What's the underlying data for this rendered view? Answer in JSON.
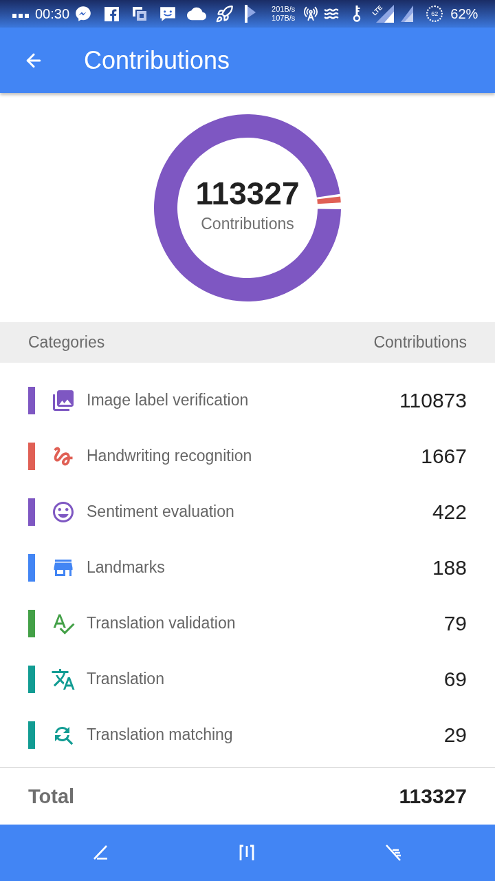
{
  "status_bar": {
    "time": "00:30",
    "net_speed": [
      "201B/s",
      "107B/s"
    ],
    "lte_label": "LTE",
    "battery_ring": "62",
    "battery": "62%"
  },
  "app_bar": {
    "title": "Contributions"
  },
  "summary": {
    "total": "113327",
    "label": "Contributions"
  },
  "table": {
    "columns": [
      "Categories",
      "Contributions"
    ],
    "rows": [
      {
        "label": "Image label verification",
        "value": "110873",
        "color": "#7e57c2"
      },
      {
        "label": "Handwriting recognition",
        "value": "1667",
        "color": "#e06055"
      },
      {
        "label": "Sentiment evaluation",
        "value": "422",
        "color": "#7e57c2"
      },
      {
        "label": "Landmarks",
        "value": "188",
        "color": "#4285f4"
      },
      {
        "label": "Translation validation",
        "value": "79",
        "color": "#43a047"
      },
      {
        "label": "Translation",
        "value": "69",
        "color": "#129c93"
      },
      {
        "label": "Translation matching",
        "value": "29",
        "color": "#129c93"
      }
    ]
  },
  "total": {
    "label": "Total",
    "value": "113327"
  }
}
